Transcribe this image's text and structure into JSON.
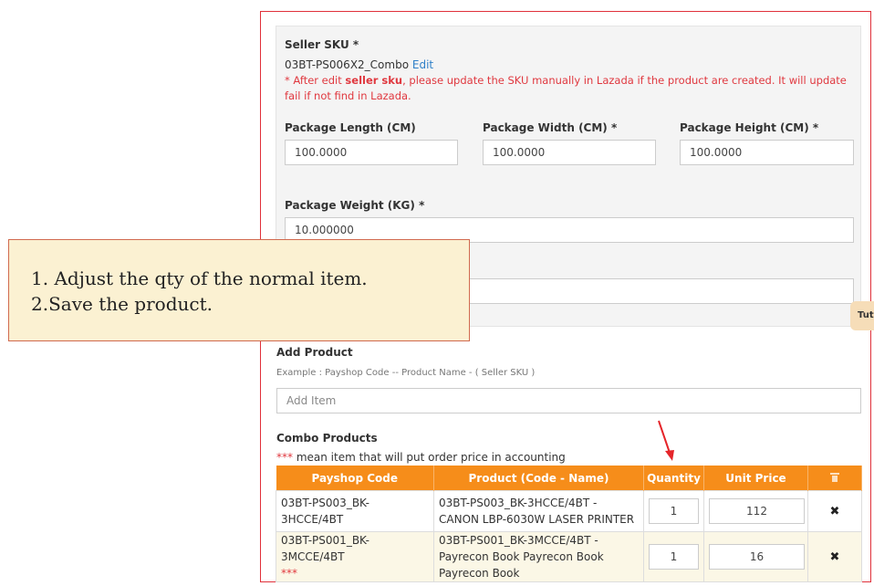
{
  "seller_sku": {
    "label": "Seller SKU *",
    "value": "03BT-PS006X2_Combo",
    "edit_link": "Edit",
    "warning_prefix": "* After edit ",
    "warning_bold": "seller sku",
    "warning_suffix": ", please update the SKU manually in Lazada if the product are created. It will update fail if not find in Lazada."
  },
  "package": {
    "length_label": "Package Length (CM)",
    "length_value": "100.0000",
    "width_label": "Package Width (CM) *",
    "width_value": "100.0000",
    "height_label": "Package Height (CM) *",
    "height_value": "100.0000",
    "weight_label": "Package Weight (KG) *",
    "weight_value": "10.000000"
  },
  "side_tab": "Tut",
  "annotation": {
    "line1": "1. Adjust the qty of the normal item.",
    "line2": "2.Save the product."
  },
  "add_product": {
    "label": "Add Product",
    "example": "Example : Payshop Code -- Product Name - ( Seller SKU )",
    "placeholder": "Add Item"
  },
  "combo": {
    "label": "Combo Products",
    "note_stars": "***",
    "note_text": " mean item that will put order price in accounting",
    "headers": [
      "Payshop Code",
      "Product (Code - Name)",
      "Quantity",
      "Unit Price"
    ],
    "rows": [
      {
        "code": "03BT-PS003_BK-3HCCE/4BT",
        "code_mark": "",
        "product": "03BT-PS003_BK-3HCCE/4BT - CANON LBP-6030W LASER PRINTER",
        "quantity": "1",
        "unit_price": "112"
      },
      {
        "code": "03BT-PS001_BK-3MCCE/4BT",
        "code_mark": "***",
        "product": "03BT-PS001_BK-3MCCE/4BT - Payrecon Book Payrecon Book Payrecon Book",
        "quantity": "1",
        "unit_price": "16"
      }
    ]
  },
  "colors": {
    "frame_border": "#e0303a",
    "table_header": "#f68d1a",
    "warning_text": "#e0383f",
    "annotation_bg": "#fbf1d2",
    "arrow": "#e5252a"
  },
  "icons": {
    "delete_all": "trash-icon",
    "remove_row": "close-icon",
    "pointer": "red-arrow-icon"
  }
}
